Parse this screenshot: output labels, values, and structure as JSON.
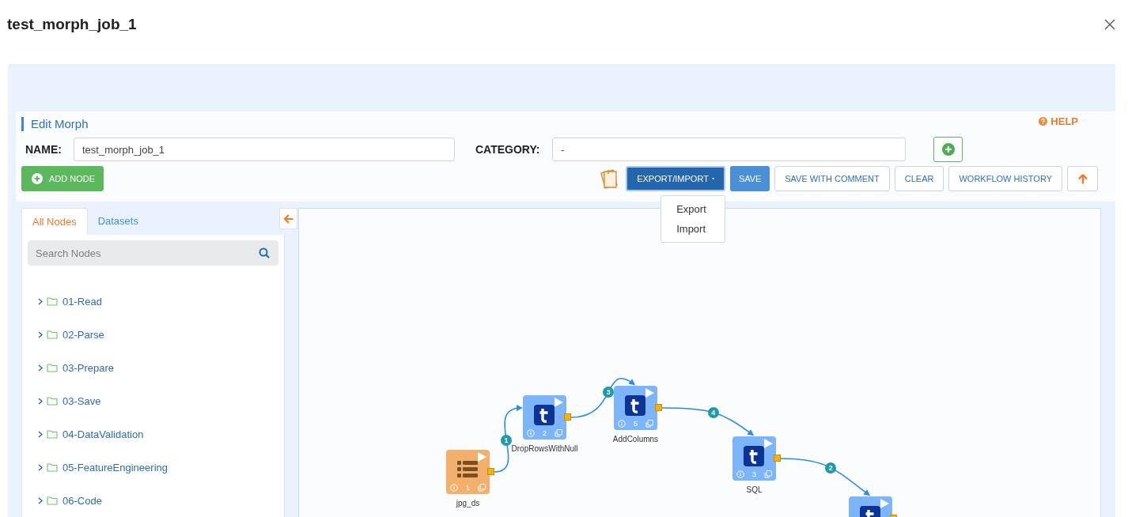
{
  "dialog": {
    "title": "test_morph_job_1"
  },
  "editor": {
    "heading": "Edit Morph",
    "help": "HELP",
    "name_label": "NAME:",
    "name_value": "test_morph_job_1",
    "category_label": "CATEGORY:",
    "category_value": "-",
    "add_node": "ADD NODE",
    "toolbar": [
      {
        "label": "EXPORT/IMPORT",
        "kind": "dropdown",
        "expanded": true
      },
      {
        "label": "SAVE",
        "kind": "primary"
      },
      {
        "label": "SAVE WITH COMMENT",
        "kind": "outline"
      },
      {
        "label": "CLEAR",
        "kind": "outline"
      },
      {
        "label": "WORKFLOW HISTORY",
        "kind": "outline"
      }
    ],
    "export_menu": [
      "Export",
      "Import"
    ]
  },
  "sidebar": {
    "tabs": [
      {
        "label": "All Nodes",
        "selected": true
      },
      {
        "label": "Datasets",
        "selected": false
      }
    ],
    "search": {
      "placeholder": "Search Nodes"
    },
    "folders": [
      {
        "label": "01-Read",
        "expanded": false
      },
      {
        "label": "02-Parse",
        "expanded": false
      },
      {
        "label": "03-Prepare",
        "expanded": false
      },
      {
        "label": "03-Save",
        "expanded": false
      },
      {
        "label": "04-DataValidation",
        "expanded": false
      },
      {
        "label": "05-FeatureEngineering",
        "expanded": false
      },
      {
        "label": "06-Code",
        "expanded": false
      }
    ]
  },
  "canvas": {
    "nodes": [
      {
        "kind": "dataset",
        "label": "jpg_ds",
        "number": "1"
      },
      {
        "kind": "transform",
        "label": "DropRowsWithNull",
        "number": "2"
      },
      {
        "kind": "transform",
        "label": "AddColumns",
        "number": "5"
      },
      {
        "kind": "transform",
        "label": "SQL",
        "number": "3"
      },
      {
        "kind": "transform"
      }
    ],
    "edges": [
      {
        "label": "1"
      },
      {
        "label": "3"
      },
      {
        "label": "4"
      },
      {
        "label": "2"
      }
    ]
  }
}
